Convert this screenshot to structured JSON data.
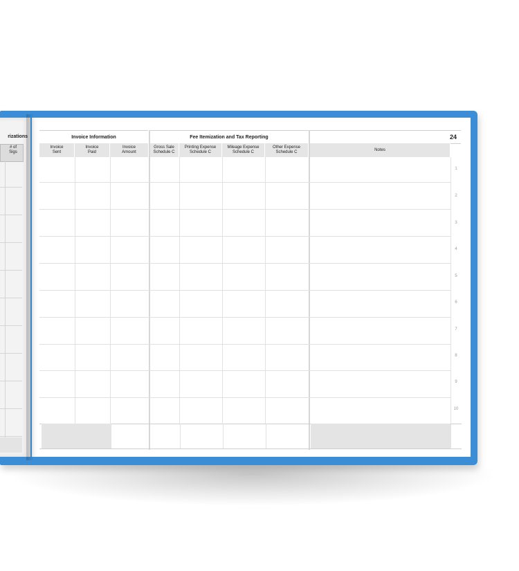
{
  "left_page": {
    "title": "rizations",
    "col_head": [
      "# of",
      "Sigs"
    ]
  },
  "page_number": "24",
  "sections": {
    "invoice": "Invoice Information",
    "fees": "Fee Itemization and Tax Reporting"
  },
  "columns": [
    [
      "Invoice",
      "Sent"
    ],
    [
      "Invoice",
      "Paid"
    ],
    [
      "Invoice",
      "Amount"
    ],
    [
      "Gross Sale",
      "Schedule C"
    ],
    [
      "Printing Expense",
      "Schedule C"
    ],
    [
      "Mileage Expense",
      "Schedule C"
    ],
    [
      "Other Expense",
      "Schedule C"
    ],
    [
      "Notes"
    ]
  ],
  "rows": [
    "1",
    "2",
    "3",
    "4",
    "5",
    "6",
    "7",
    "8",
    "9",
    "10"
  ],
  "colors": {
    "cover": "#3b8ed6",
    "header_fill": "#e5e5e5",
    "row_number": "#9a9a9a"
  }
}
